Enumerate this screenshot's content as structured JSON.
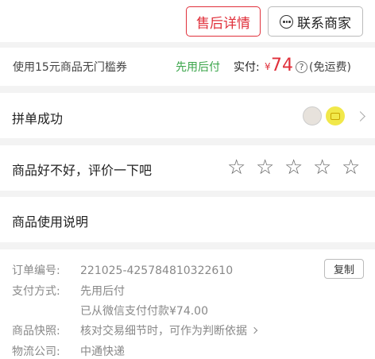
{
  "header": {
    "after_sales_label": "售后详情",
    "contact_label": "联系商家"
  },
  "coupon_row": {
    "coupon_text": "使用15元商品无门槛券",
    "pay_later": "先用后付",
    "paid_label": "实付:",
    "currency": "¥",
    "amount": "74",
    "help_symbol": "?",
    "shipping_note": "(免运费)"
  },
  "group_row": {
    "title": "拼单成功"
  },
  "review_row": {
    "title": "商品好不好，评价一下吧",
    "star_count": 5,
    "star_glyph": "☆"
  },
  "manual_row": {
    "title": "商品使用说明"
  },
  "order": {
    "number_label": "订单编号:",
    "number_value": "221025-425784810322610",
    "copy_label": "复制",
    "payment_label": "支付方式:",
    "payment_value": "先用后付",
    "payment_detail": "已从微信支付付款¥74.00",
    "snapshot_label": "商品快照:",
    "snapshot_value": "核对交易细节时，可作为判断依据",
    "logistics_label": "物流公司:",
    "logistics_value": "中通快递"
  },
  "colors": {
    "accent": "#e0303b",
    "green": "#3aa54a"
  }
}
